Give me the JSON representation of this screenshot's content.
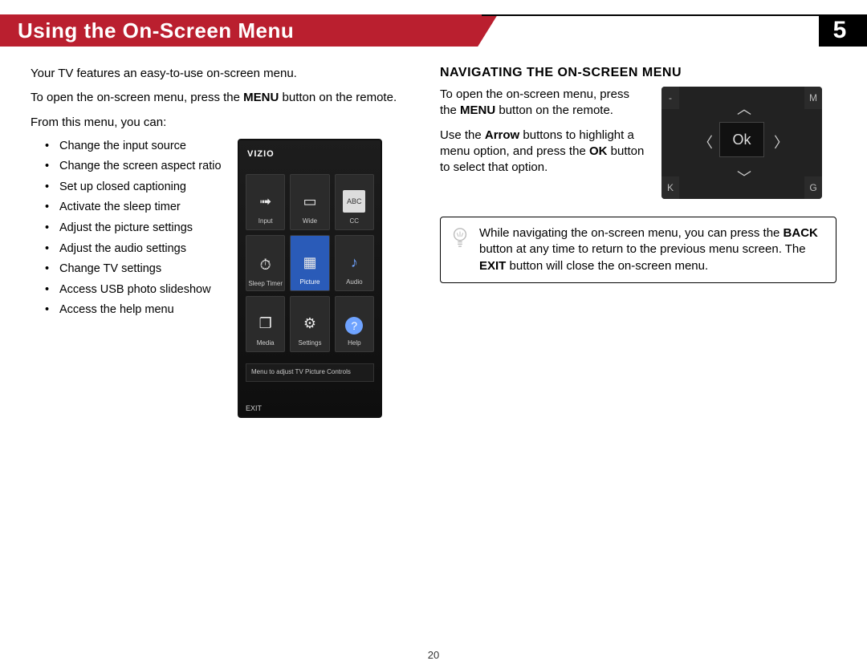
{
  "header": {
    "title": "Using the On-Screen Menu",
    "chapter_number": "5"
  },
  "left": {
    "intro": "Your TV features an easy-to-use on-screen menu.",
    "open_pre": "To open the on-screen menu, press the ",
    "open_bold": "MENU",
    "open_post": " button on the remote.",
    "from_menu": "From this menu, you can:",
    "bullets": [
      "Change the input source",
      "Change the screen aspect ratio",
      "Set up closed captioning",
      "Activate the sleep timer",
      "Adjust the picture settings",
      "Adjust the audio settings",
      "Change TV settings",
      "Access USB photo slideshow",
      "Access the help menu"
    ]
  },
  "tv_menu": {
    "brand": "VIZIO",
    "cells": [
      {
        "label": "Input",
        "glyph": "➟"
      },
      {
        "label": "Wide",
        "glyph": "▭"
      },
      {
        "label": "CC",
        "glyph": "ABC"
      },
      {
        "label": "Sleep Timer",
        "glyph": "⏱"
      },
      {
        "label": "Picture",
        "glyph": "▦",
        "selected": true
      },
      {
        "label": "Audio",
        "glyph": "♪"
      },
      {
        "label": "Media",
        "glyph": "❐"
      },
      {
        "label": "Settings",
        "glyph": "⚙"
      },
      {
        "label": "Help",
        "glyph": "?"
      }
    ],
    "status_text": "Menu to adjust TV Picture Controls",
    "exit_label": "EXIT"
  },
  "right": {
    "section_title": "NAVIGATING THE ON-SCREEN MENU",
    "p1_pre": "To open the on-screen menu, press the ",
    "p1_bold": "MENU",
    "p1_post": " button on the remote.",
    "p2_pre": "Use the ",
    "p2_bold1": "Arrow",
    "p2_mid": " buttons to highlight a menu option, and press the ",
    "p2_bold2": "OK",
    "p2_post": " button to select that option.",
    "dpad": {
      "ok": "Ok",
      "edge_tr": "M",
      "edge_br": "G",
      "edge_bl": "K",
      "edge_tl": "-"
    },
    "tip_pre": "While navigating the on-screen menu, you can press the ",
    "tip_bold1": "BACK",
    "tip_mid": " button at any time to return to the previous menu screen. The ",
    "tip_bold2": "EXIT",
    "tip_post": " button will close the on-screen menu."
  },
  "page_number": "20"
}
